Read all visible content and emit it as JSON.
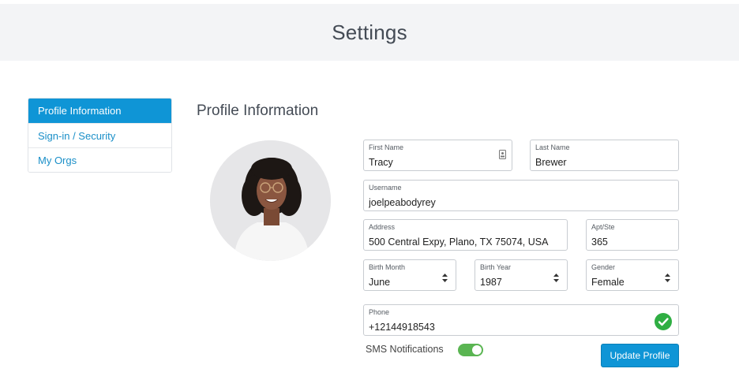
{
  "header": {
    "title": "Settings"
  },
  "sidebar": {
    "items": [
      {
        "label": "Profile Information",
        "active": true
      },
      {
        "label": "Sign-in / Security",
        "active": false
      },
      {
        "label": "My Orgs",
        "active": false
      }
    ]
  },
  "main": {
    "section_title": "Profile Information",
    "avatar_icon": "profile-photo",
    "fields": {
      "first_name": {
        "label": "First Name",
        "value": "Tracy"
      },
      "last_name": {
        "label": "Last Name",
        "value": "Brewer"
      },
      "username": {
        "label": "Username",
        "value": "joelpeabodyrey"
      },
      "address": {
        "label": "Address",
        "value": "500 Central Expy, Plano, TX 75074, USA"
      },
      "apt": {
        "label": "Apt/Ste",
        "value": "365"
      },
      "birth_month": {
        "label": "Birth Month",
        "value": "June"
      },
      "birth_year": {
        "label": "Birth Year",
        "value": "1987"
      },
      "gender": {
        "label": "Gender",
        "value": "Female"
      },
      "phone": {
        "label": "Phone",
        "value": "+12144918543"
      }
    },
    "sms": {
      "label": "SMS Notifications",
      "enabled": true
    },
    "update_button": "Update Profile"
  },
  "colors": {
    "accent": "#0f95d6",
    "toggle_on": "#5ab552",
    "verified": "#2fae43",
    "header_bg": "#f3f4f6"
  }
}
